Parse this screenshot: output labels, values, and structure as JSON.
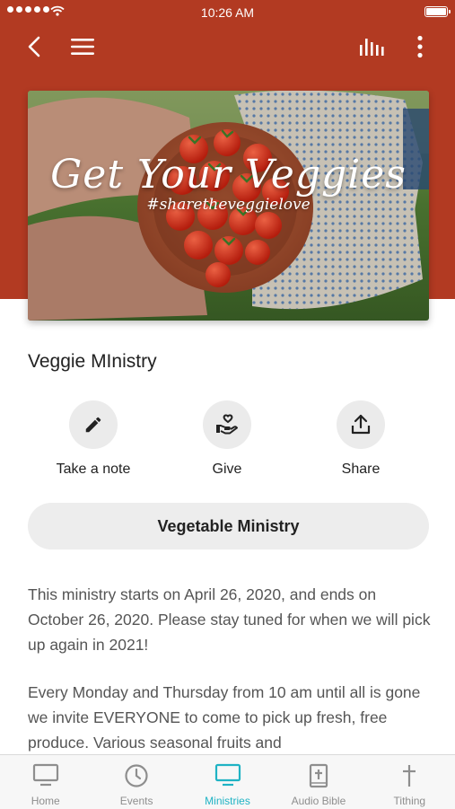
{
  "status_bar": {
    "time": "10:26 AM"
  },
  "hero": {
    "title": "Get Your Veggies",
    "tagline": "#sharetheveggielove"
  },
  "ministry": {
    "title": "Veggie MInistry"
  },
  "actions": [
    {
      "label": "Take a note",
      "icon": "pencil-icon"
    },
    {
      "label": "Give",
      "icon": "give-heart-hand-icon"
    },
    {
      "label": "Share",
      "icon": "share-icon"
    }
  ],
  "main_button": {
    "label": "Vegetable Ministry"
  },
  "description": [
    "This ministry starts on April 26, 2020, and ends on October 26, 2020.  Please stay tuned for when we will pick up again in 2021!",
    "Every Monday and Thursday from 10 am until all is gone we invite EVERYONE to come to pick up fresh, free produce. Various seasonal fruits and"
  ],
  "tabs": [
    {
      "label": "Home",
      "icon": "tv-icon",
      "active": false
    },
    {
      "label": "Events",
      "icon": "clock-icon",
      "active": false
    },
    {
      "label": "Ministries",
      "icon": "tv-icon",
      "active": true
    },
    {
      "label": "Audio Bible",
      "icon": "bible-icon",
      "active": false
    },
    {
      "label": "Tithing",
      "icon": "cross-icon",
      "active": false
    }
  ],
  "colors": {
    "header": "#b23a22",
    "active_tab": "#1fb3c4",
    "inactive_tab": "#8e8e8e",
    "button_bg": "#ededed"
  }
}
